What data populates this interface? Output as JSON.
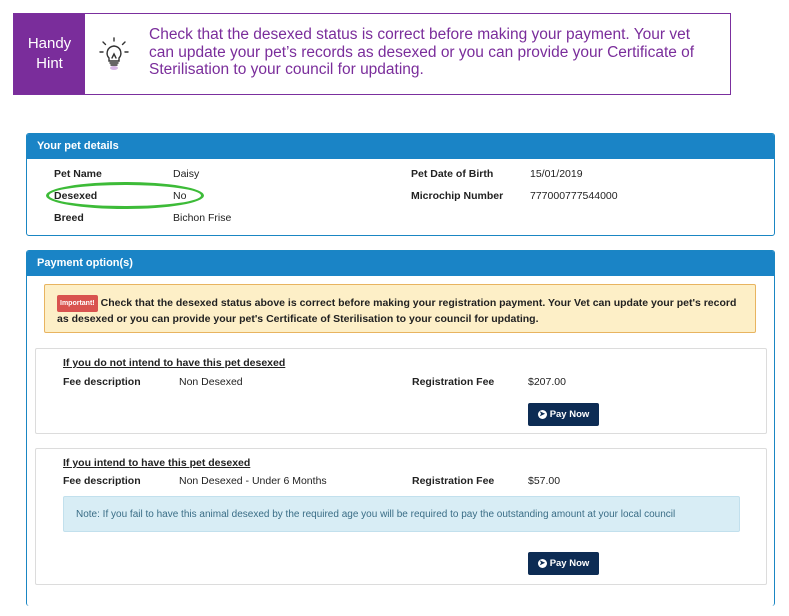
{
  "hint": {
    "label_line1": "Handy",
    "label_line2": "Hint",
    "icon": "lightbulb-icon",
    "text": "Check that the desexed status is correct before making your payment.  Your vet can update your pet’s records as desexed or you can provide your Certificate of Sterilisation to your council for updating."
  },
  "pet_details": {
    "heading": "Your pet details",
    "pet_name_label": "Pet Name",
    "pet_name": "Daisy",
    "desexed_label": "Desexed",
    "desexed": "No",
    "breed_label": "Breed",
    "breed": "Bichon Frise",
    "dob_label": "Pet Date of Birth",
    "dob": "15/01/2019",
    "microchip_label": "Microchip Number",
    "microchip": "777000777544000"
  },
  "payment": {
    "heading": "Payment option(s)",
    "important_badge": "Important!",
    "important_text": "Check that the desexed status above is correct before making your registration payment. Your Vet can update your pet's record as desexed or you can provide your pet's Certificate of Sterilisation to your council for updating.",
    "options": [
      {
        "title": "If you do not intend to have this pet desexed",
        "fee_desc_label": "Fee description",
        "fee_desc": "Non Desexed",
        "reg_fee_label": "Registration Fee",
        "reg_fee": "$207.00",
        "button": "Pay Now"
      },
      {
        "title": "If you intend to have this pet desexed",
        "fee_desc_label": "Fee description",
        "fee_desc": "Non Desexed - Under 6 Months",
        "reg_fee_label": "Registration Fee",
        "reg_fee": "$57.00",
        "note": "Note: If you fail to have this animal desexed by the required age you will be required to pay the outstanding amount at your local council",
        "button": "Pay Now"
      }
    ]
  },
  "colors": {
    "hint_purple": "#7a2d9b",
    "panel_blue": "#1a84c6",
    "button_navy": "#0d2c54",
    "highlight_green": "#3dbb38"
  }
}
